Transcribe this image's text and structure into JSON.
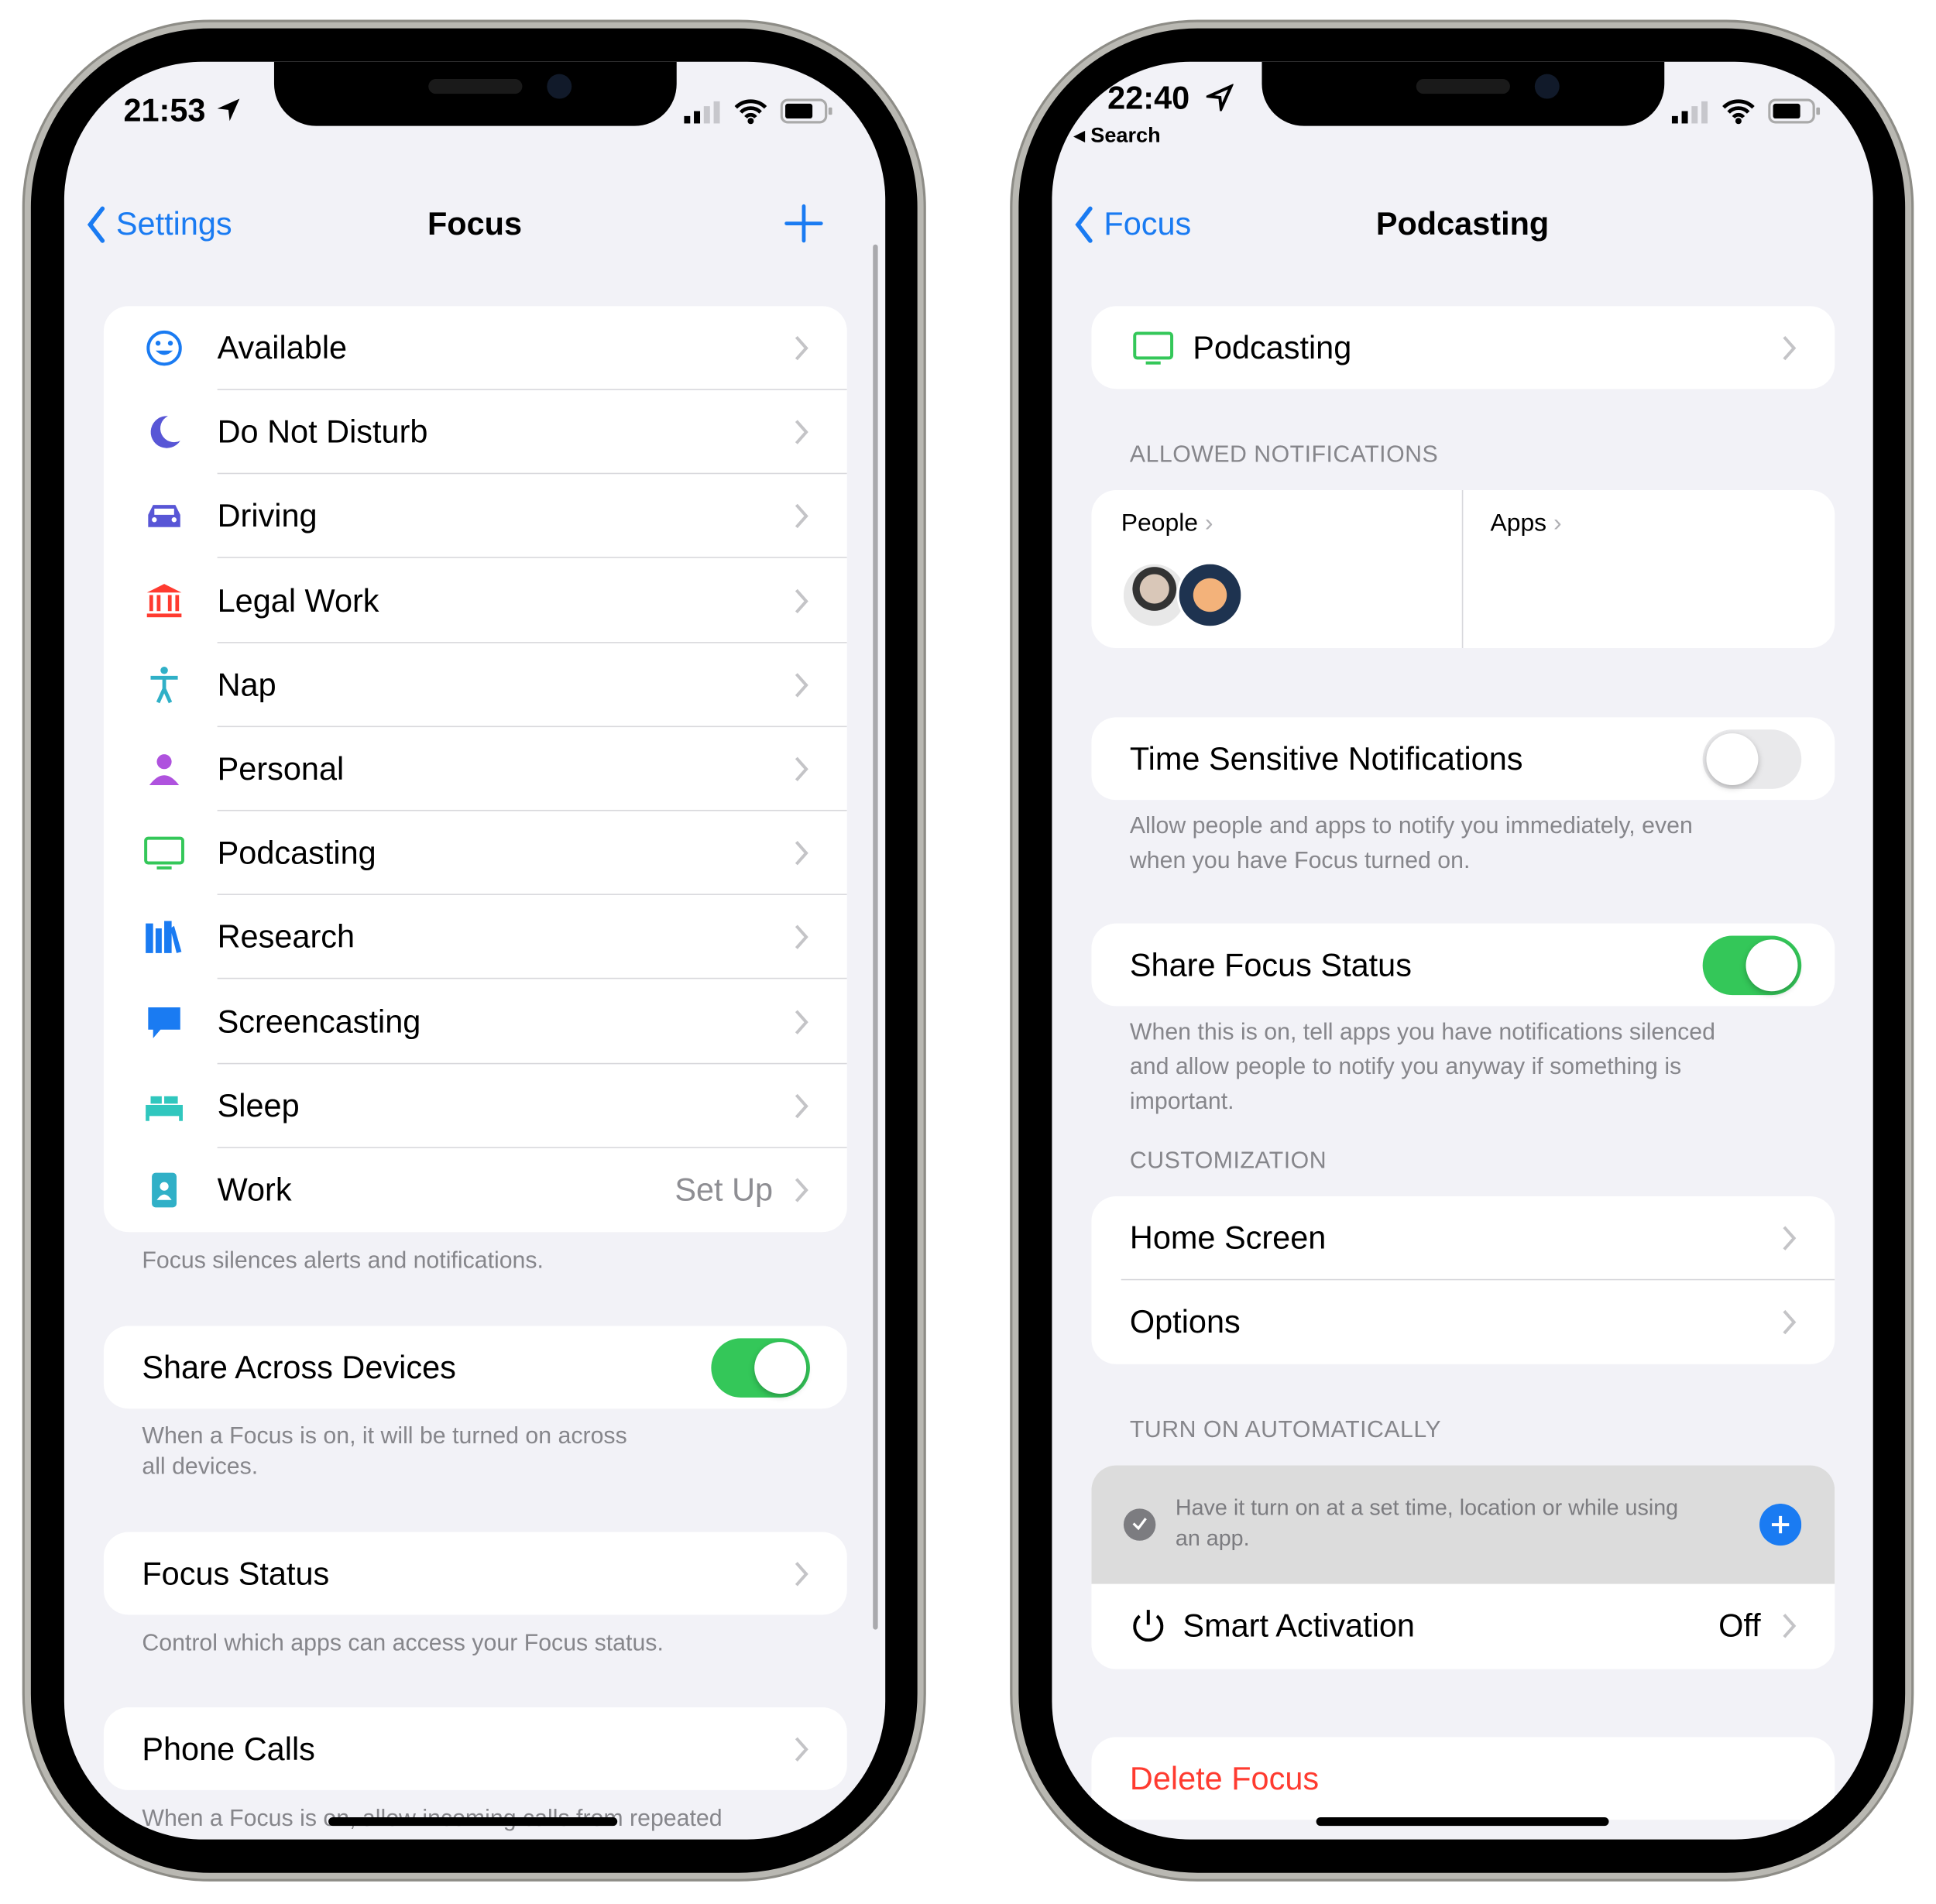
{
  "colors": {
    "accent": "#1a7bf2",
    "toggle_on": "#34c759",
    "toggle_off": "#e9e9eb",
    "destructive": "#ff3b30",
    "background": "#f2f2f7"
  },
  "left": {
    "status": {
      "time": "21:53",
      "location_icon": "location-arrow-icon",
      "signal_icon": "cellular-signal-icon",
      "wifi_icon": "wifi-icon",
      "battery_icon": "battery-icon"
    },
    "nav": {
      "back_label": "Settings",
      "title": "Focus",
      "add_icon": "plus-icon"
    },
    "focus_modes": [
      {
        "label": "Available",
        "icon": "smiley-icon",
        "color": "#1a7bf2"
      },
      {
        "label": "Do Not Disturb",
        "icon": "moon-icon",
        "color": "#5856d6"
      },
      {
        "label": "Driving",
        "icon": "car-icon",
        "color": "#5856d6"
      },
      {
        "label": "Legal Work",
        "icon": "bank-icon",
        "color": "#ff3b30"
      },
      {
        "label": "Nap",
        "icon": "accessibility-figure-icon",
        "color": "#30b0c7"
      },
      {
        "label": "Personal",
        "icon": "person-icon",
        "color": "#af52de"
      },
      {
        "label": "Podcasting",
        "icon": "monitor-icon",
        "color": "#34c759"
      },
      {
        "label": "Research",
        "icon": "books-icon",
        "color": "#1a7bf2"
      },
      {
        "label": "Screencasting",
        "icon": "speech-bubble-icon",
        "color": "#1a7bf2"
      },
      {
        "label": "Sleep",
        "icon": "bed-icon",
        "color": "#30c7be"
      },
      {
        "label": "Work",
        "icon": "id-badge-icon",
        "color": "#30b0c7",
        "value": "Set Up"
      }
    ],
    "modes_footer": "Focus silences alerts and notifications.",
    "share_across": {
      "label": "Share Across Devices",
      "on": true,
      "footer_1": "When a Focus is on, it will be turned on across",
      "footer_2": "all devices."
    },
    "focus_status": {
      "label": "Focus Status",
      "footer": "Control which apps can access your Focus status."
    },
    "phone_calls": {
      "label": "Phone Calls",
      "footer": "When a Focus is on, allow incoming calls from repeated"
    }
  },
  "right": {
    "status": {
      "time": "22:40",
      "back_app": "Search"
    },
    "nav": {
      "back_label": "Focus",
      "title": "Podcasting"
    },
    "focus_name": {
      "label": "Podcasting",
      "icon": "monitor-icon"
    },
    "allowed_header": "ALLOWED NOTIFICATIONS",
    "people_label": "People",
    "apps_label": "Apps",
    "time_sensitive": {
      "label": "Time Sensitive Notifications",
      "on": false,
      "footer_1": "Allow people and apps to notify you immediately, even",
      "footer_2": "when you have Focus turned on."
    },
    "share_status": {
      "label": "Share Focus Status",
      "on": true,
      "footer_1": "When this is on, tell apps you have notifications silenced",
      "footer_2": "and allow people to notify you anyway if something is",
      "footer_3": "important."
    },
    "customization_header": "CUSTOMIZATION",
    "home_screen": "Home Screen",
    "options": "Options",
    "auto_header": "TURN ON AUTOMATICALLY",
    "auto_hint_1": "Have it turn on at a set time, location or while using",
    "auto_hint_2": "an app.",
    "smart_activation": {
      "label": "Smart Activation",
      "value": "Off"
    },
    "delete": "Delete Focus"
  }
}
